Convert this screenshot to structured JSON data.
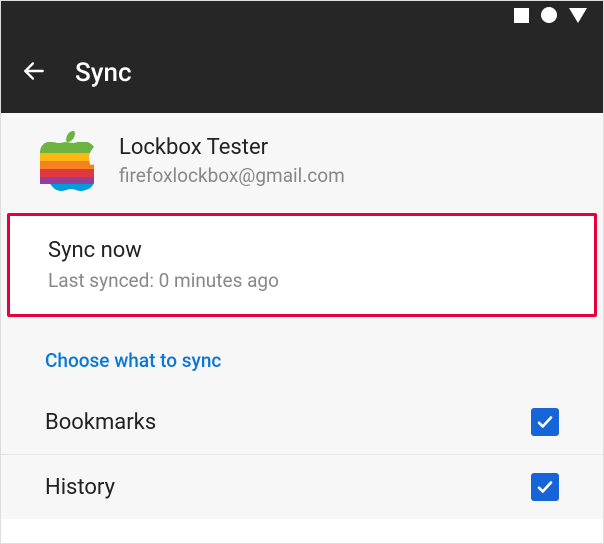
{
  "header": {
    "title": "Sync"
  },
  "account": {
    "name": "Lockbox Tester",
    "email": "firefoxlockbox@gmail.com"
  },
  "sync": {
    "action_label": "Sync now",
    "last_synced": "Last synced: 0 minutes ago"
  },
  "choose_section": {
    "label": "Choose what to sync",
    "items": [
      {
        "label": "Bookmarks",
        "checked": true
      },
      {
        "label": "History",
        "checked": true
      }
    ]
  }
}
